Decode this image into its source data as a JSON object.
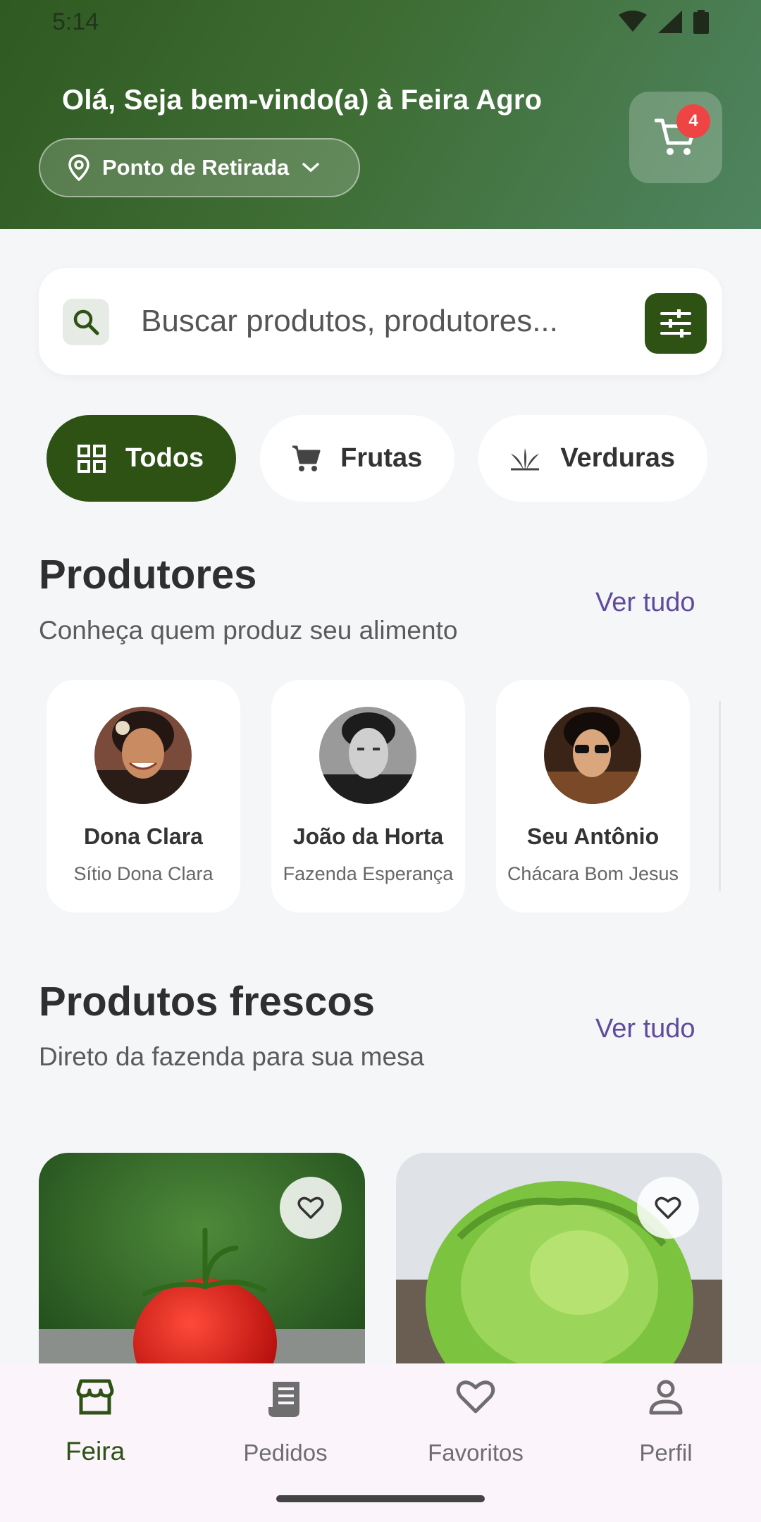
{
  "status_bar": {
    "time": "5:14"
  },
  "header": {
    "greeting": "Olá, Seja bem-vindo(a) à Feira Agro",
    "location_label": "Ponto de Retirada",
    "cart_count": "4"
  },
  "search": {
    "placeholder": "Buscar produtos, produtores..."
  },
  "categories": [
    {
      "label": "Todos",
      "icon": "grid-icon",
      "active": true
    },
    {
      "label": "Frutas",
      "icon": "cart-icon",
      "active": false
    },
    {
      "label": "Verduras",
      "icon": "leaf-icon",
      "active": false
    }
  ],
  "producers_section": {
    "title": "Produtores",
    "subtitle": "Conheça quem produz seu alimento",
    "see_all": "Ver tudo",
    "items": [
      {
        "name": "Dona Clara",
        "farm": "Sítio Dona Clara"
      },
      {
        "name": "João da Horta",
        "farm": "Fazenda Esperança"
      },
      {
        "name": "Seu Antônio",
        "farm": "Chácara Bom Jesus"
      }
    ]
  },
  "products_section": {
    "title": "Produtos frescos",
    "subtitle": "Direto da fazenda para sua mesa",
    "see_all": "Ver tudo"
  },
  "bottom_nav": [
    {
      "label": "Feira",
      "icon": "store-icon",
      "active": true
    },
    {
      "label": "Pedidos",
      "icon": "receipt-icon",
      "active": false
    },
    {
      "label": "Favoritos",
      "icon": "heart-icon",
      "active": false
    },
    {
      "label": "Perfil",
      "icon": "person-icon",
      "active": false
    }
  ],
  "colors": {
    "primary": "#2d5214",
    "accent_link": "#5f4b9c",
    "badge": "#ef4444",
    "background": "#f5f6f8"
  }
}
